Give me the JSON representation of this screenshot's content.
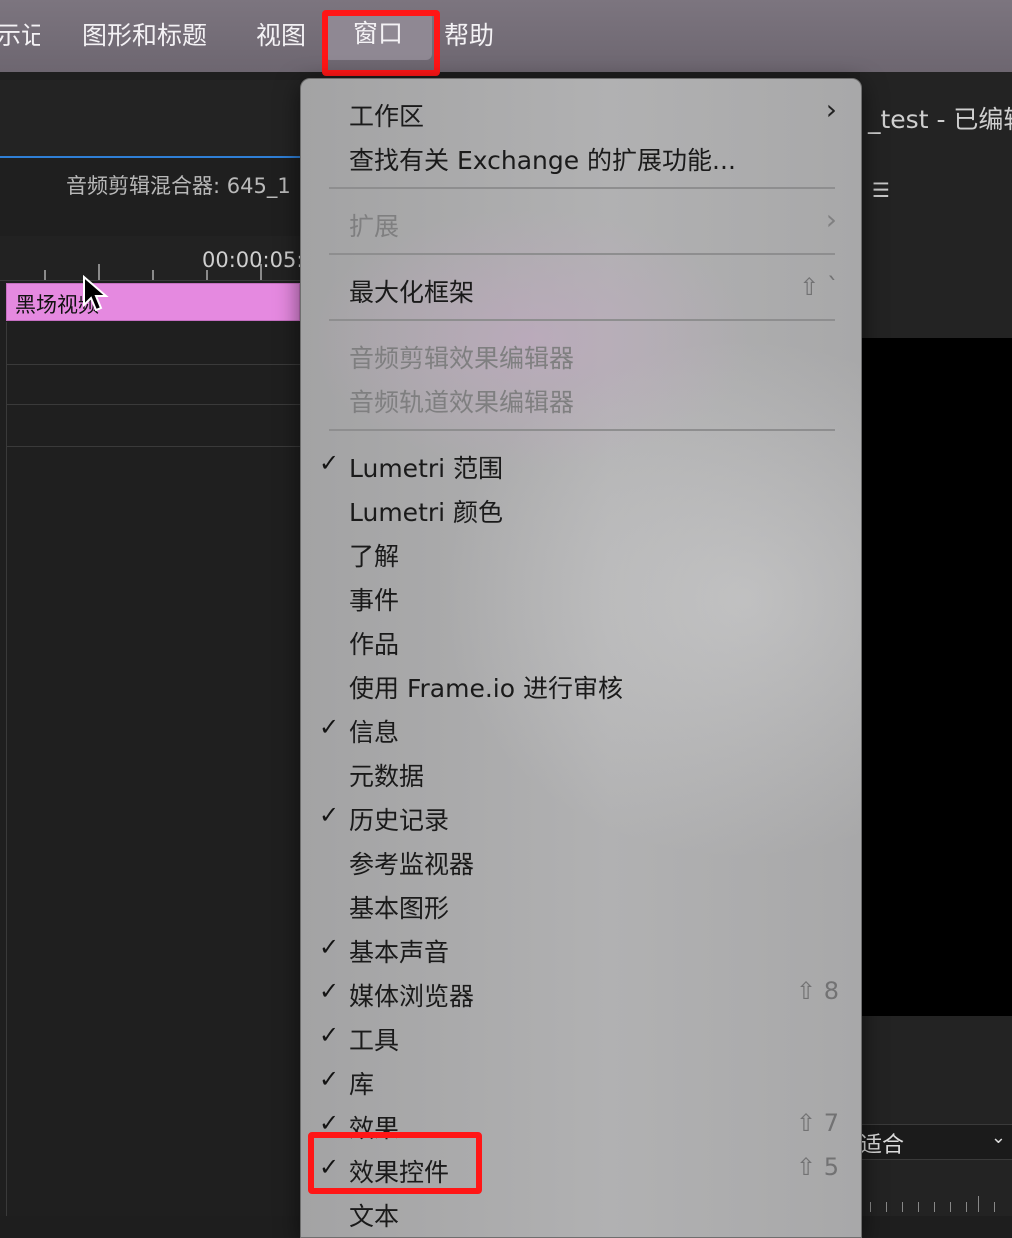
{
  "menubar": {
    "items": [
      {
        "label": "标记",
        "visible_label": "示记"
      },
      {
        "label": "图形和标题"
      },
      {
        "label": "视图"
      },
      {
        "label": "窗口"
      },
      {
        "label": "帮助"
      }
    ]
  },
  "left_panel": {
    "title": "音频剪辑混合器: 645_1",
    "timecode": "00:00:05:",
    "clip_label": "黑场视频"
  },
  "right_panel": {
    "title": "_test - 已编辑",
    "menu_icon": "hamburger-icon",
    "fit_label": "适合",
    "fit_chevron": "⌄"
  },
  "dropdown": {
    "items": [
      {
        "label": "工作区",
        "submenu": true
      },
      {
        "label": "查找有关 Exchange 的扩展功能..."
      },
      {
        "label": "扩展",
        "submenu": true,
        "disabled": true
      },
      {
        "label": "最大化框架",
        "shortcut": "⇧ `"
      },
      {
        "label": "音频剪辑效果编辑器",
        "disabled": true
      },
      {
        "label": "音频轨道效果编辑器",
        "disabled": true
      },
      {
        "label": "Lumetri 范围",
        "checked": true
      },
      {
        "label": "Lumetri 颜色"
      },
      {
        "label": "了解"
      },
      {
        "label": "事件"
      },
      {
        "label": "作品"
      },
      {
        "label": "使用 Frame.io 进行审核"
      },
      {
        "label": "信息",
        "checked": true
      },
      {
        "label": "元数据"
      },
      {
        "label": "历史记录",
        "checked": true
      },
      {
        "label": "参考监视器"
      },
      {
        "label": "基本图形"
      },
      {
        "label": "基本声音",
        "checked": true
      },
      {
        "label": "媒体浏览器",
        "checked": true,
        "shortcut": "⇧ 8"
      },
      {
        "label": "工具",
        "checked": true
      },
      {
        "label": "库",
        "checked": true
      },
      {
        "label": "效果",
        "checked": true,
        "shortcut": "⇧ 7"
      },
      {
        "label": "效果控件",
        "checked": true,
        "shortcut": "⇧ 5"
      },
      {
        "label": "文本"
      }
    ],
    "check_glyph": "✓",
    "submenu_glyph": "›"
  },
  "colors": {
    "highlight": "#ff1616",
    "clip": "#e589e0",
    "menubar": "#7c757f",
    "menu_bg": "#acacad"
  }
}
